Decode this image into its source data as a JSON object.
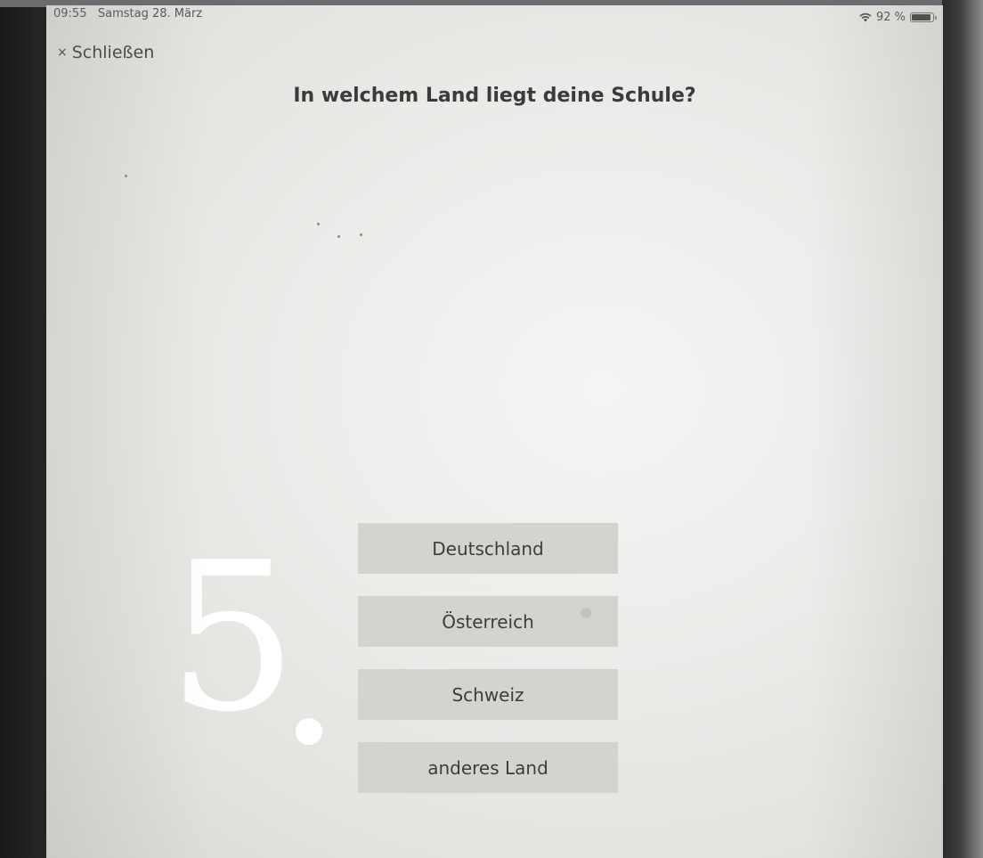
{
  "status_bar": {
    "time": "09:55",
    "date": "Samstag 28. März",
    "battery_text": "92 %",
    "battery_level": 0.92
  },
  "header": {
    "close_icon": "×",
    "close_label": "Schließen"
  },
  "question": {
    "title": "In welchem Land liegt deine Schule?"
  },
  "answers": [
    {
      "label": "Deutschland"
    },
    {
      "label": "Österreich"
    },
    {
      "label": "Schweiz"
    },
    {
      "label": "anderes Land"
    }
  ],
  "overlay": {
    "step_number": "5",
    "step_color": "#ffffff"
  },
  "colors": {
    "answer_background": "#d3d4d0",
    "screen_background": "#ecedea",
    "text": "#3b3b3b"
  }
}
